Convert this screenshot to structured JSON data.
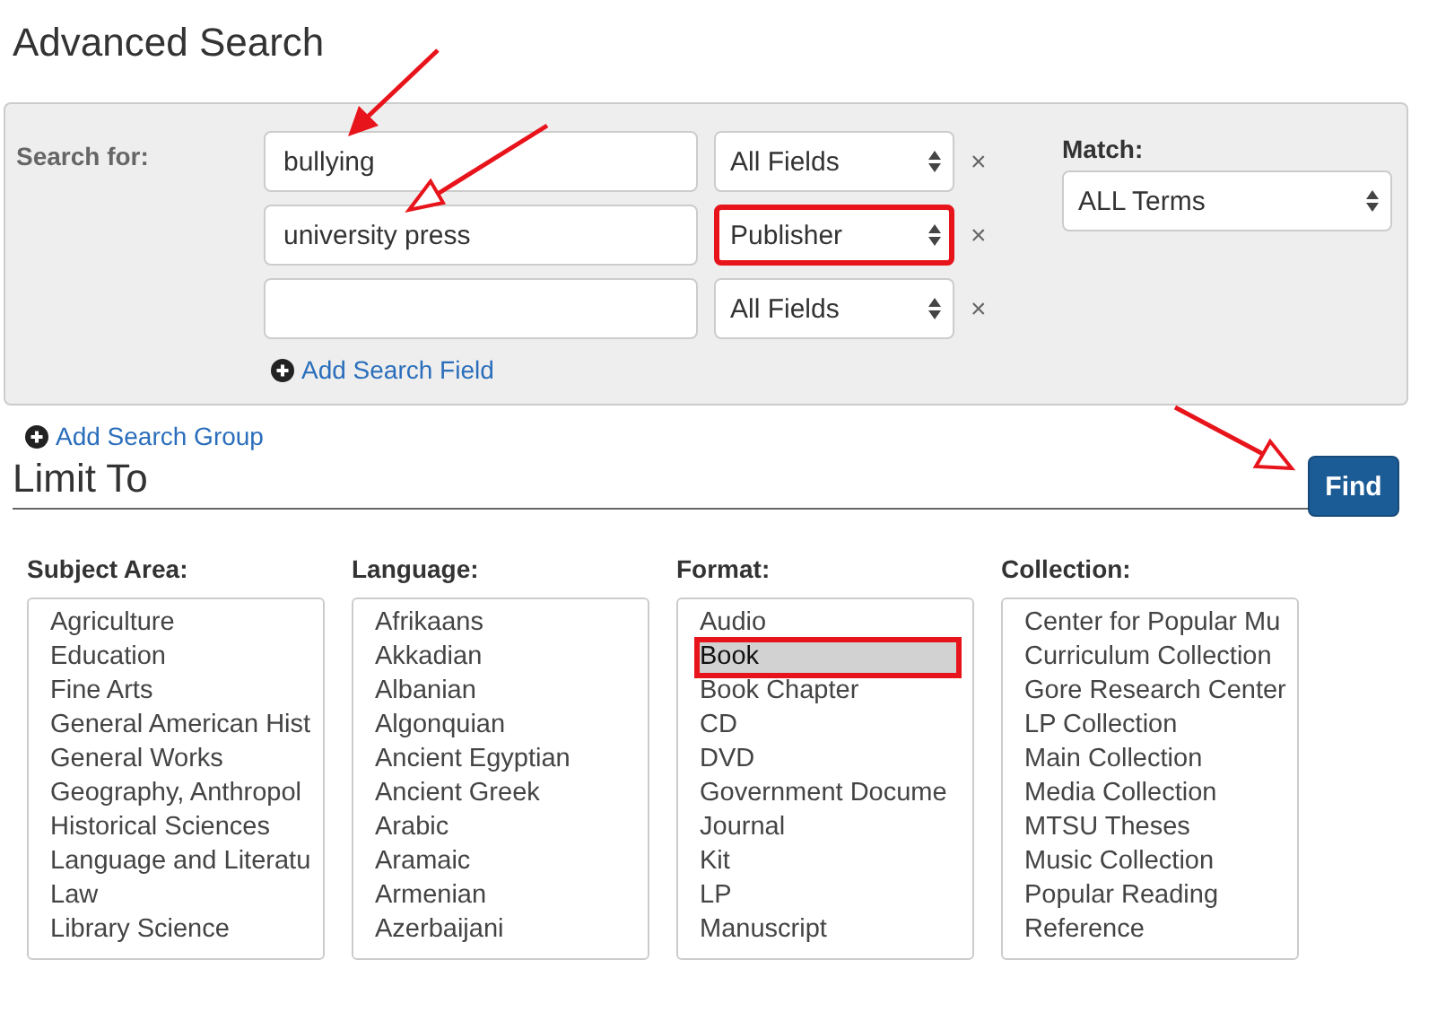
{
  "title": "Advanced Search",
  "search": {
    "label": "Search for:",
    "rows": [
      {
        "value": "bullying",
        "field": "All Fields",
        "highlighted": false,
        "remove": "×"
      },
      {
        "value": "university press",
        "field": "Publisher",
        "highlighted": true,
        "remove": "×"
      },
      {
        "value": "",
        "field": "All Fields",
        "highlighted": false,
        "remove": "×"
      }
    ],
    "add_field": "Add Search Field",
    "match": {
      "label": "Match:",
      "value": "ALL Terms"
    }
  },
  "add_group": "Add Search Group",
  "limit": {
    "title": "Limit To",
    "find": "Find",
    "facets": [
      {
        "label": "Subject Area:",
        "items": [
          {
            "text": "Agriculture",
            "selected": false,
            "highlighted": false
          },
          {
            "text": "Education",
            "selected": false,
            "highlighted": false
          },
          {
            "text": "Fine Arts",
            "selected": false,
            "highlighted": false
          },
          {
            "text": "General American Hist",
            "selected": false,
            "highlighted": false
          },
          {
            "text": "General Works",
            "selected": false,
            "highlighted": false
          },
          {
            "text": "Geography, Anthropol",
            "selected": false,
            "highlighted": false
          },
          {
            "text": "Historical Sciences",
            "selected": false,
            "highlighted": false
          },
          {
            "text": "Language and Literatu",
            "selected": false,
            "highlighted": false
          },
          {
            "text": "Law",
            "selected": false,
            "highlighted": false
          },
          {
            "text": "Library Science",
            "selected": false,
            "highlighted": false
          }
        ]
      },
      {
        "label": "Language:",
        "items": [
          {
            "text": "Afrikaans",
            "selected": false,
            "highlighted": false
          },
          {
            "text": "Akkadian",
            "selected": false,
            "highlighted": false
          },
          {
            "text": "Albanian",
            "selected": false,
            "highlighted": false
          },
          {
            "text": "Algonquian",
            "selected": false,
            "highlighted": false
          },
          {
            "text": "Ancient Egyptian",
            "selected": false,
            "highlighted": false
          },
          {
            "text": "Ancient Greek",
            "selected": false,
            "highlighted": false
          },
          {
            "text": "Arabic",
            "selected": false,
            "highlighted": false
          },
          {
            "text": "Aramaic",
            "selected": false,
            "highlighted": false
          },
          {
            "text": "Armenian",
            "selected": false,
            "highlighted": false
          },
          {
            "text": "Azerbaijani",
            "selected": false,
            "highlighted": false
          }
        ]
      },
      {
        "label": "Format:",
        "items": [
          {
            "text": "Audio",
            "selected": false,
            "highlighted": false
          },
          {
            "text": "Book",
            "selected": true,
            "highlighted": true
          },
          {
            "text": "Book Chapter",
            "selected": false,
            "highlighted": false
          },
          {
            "text": "CD",
            "selected": false,
            "highlighted": false
          },
          {
            "text": "DVD",
            "selected": false,
            "highlighted": false
          },
          {
            "text": "Government Docume",
            "selected": false,
            "highlighted": false
          },
          {
            "text": "Journal",
            "selected": false,
            "highlighted": false
          },
          {
            "text": "Kit",
            "selected": false,
            "highlighted": false
          },
          {
            "text": "LP",
            "selected": false,
            "highlighted": false
          },
          {
            "text": "Manuscript",
            "selected": false,
            "highlighted": false
          }
        ]
      },
      {
        "label": "Collection:",
        "items": [
          {
            "text": "Center for Popular Mu",
            "selected": false,
            "highlighted": false
          },
          {
            "text": "Curriculum Collection",
            "selected": false,
            "highlighted": false
          },
          {
            "text": "Gore Research Center",
            "selected": false,
            "highlighted": false
          },
          {
            "text": "LP Collection",
            "selected": false,
            "highlighted": false
          },
          {
            "text": "Main Collection",
            "selected": false,
            "highlighted": false
          },
          {
            "text": "Media Collection",
            "selected": false,
            "highlighted": false
          },
          {
            "text": "MTSU Theses",
            "selected": false,
            "highlighted": false
          },
          {
            "text": "Music Collection",
            "selected": false,
            "highlighted": false
          },
          {
            "text": "Popular Reading",
            "selected": false,
            "highlighted": false
          },
          {
            "text": "Reference",
            "selected": false,
            "highlighted": false
          }
        ]
      }
    ]
  }
}
